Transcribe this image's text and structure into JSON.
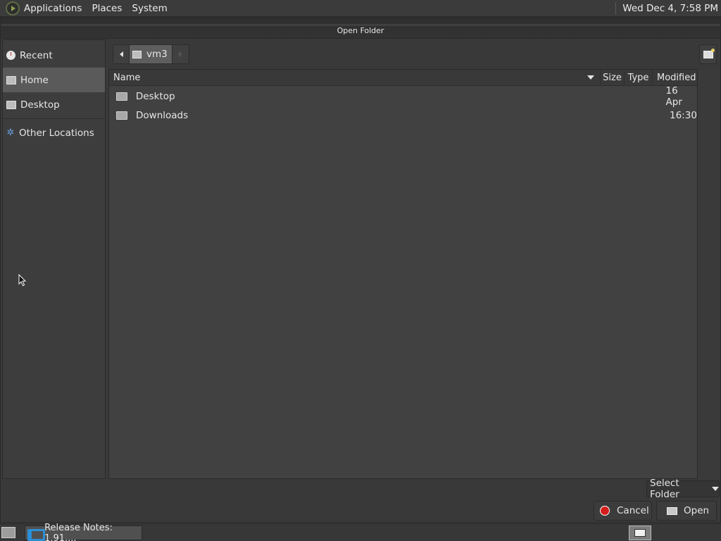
{
  "top_panel": {
    "menus": [
      "Applications",
      "Places",
      "System"
    ],
    "clock": "Wed Dec  4,  7:58 PM"
  },
  "dialog": {
    "title": "Open Folder",
    "sidebar": {
      "items": [
        {
          "label": "Recent",
          "icon": "recent-clock-icon"
        },
        {
          "label": "Home",
          "icon": "home-folder-icon",
          "active": true
        },
        {
          "label": "Desktop",
          "icon": "desktop-folder-icon"
        },
        {
          "label": "Other Locations",
          "icon": "network-icon"
        }
      ]
    },
    "path": {
      "current": "vm3"
    },
    "columns": [
      "Name",
      "Size",
      "Type",
      "Modified"
    ],
    "files": [
      {
        "name": "Desktop",
        "size": "",
        "type": "",
        "modified": "16 Apr"
      },
      {
        "name": "Downloads",
        "size": "",
        "type": "",
        "modified": "16:30"
      }
    ],
    "filter": "Select Folder",
    "cancel_label": "Cancel",
    "open_label": "Open"
  },
  "taskbar": {
    "task_label": "Release Notes: 1.91...."
  },
  "colors": {
    "panel_bg": "#3b3b3b",
    "dialog_bg": "#393939",
    "selected_bg": "#5a5a5a",
    "cancel_red": "#d41c1c",
    "vscode_blue": "#2b8fd6"
  }
}
